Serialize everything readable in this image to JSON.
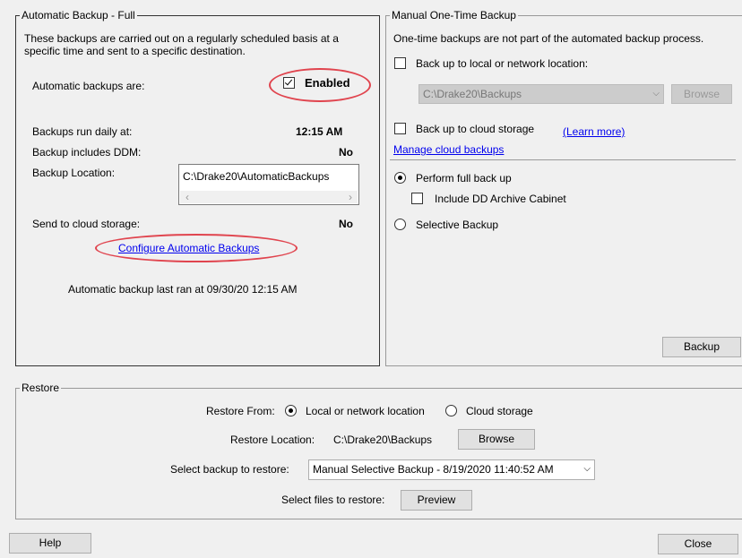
{
  "auto_backup": {
    "title": "Automatic Backup - Full",
    "description_line1": "These backups are carried out on a regularly scheduled basis at a",
    "description_line2": "specific time and sent to a specific destination.",
    "status_label": "Automatic backups are:",
    "enabled_label": "Enabled",
    "enabled_checked": true,
    "run_daily_label": "Backups run daily at:",
    "run_daily_value": "12:15 AM",
    "ddm_label": "Backup includes DDM:",
    "ddm_value": "No",
    "location_label": "Backup Location:",
    "location_value": "C:\\Drake20\\AutomaticBackups",
    "cloud_label": "Send to cloud storage:",
    "cloud_value": "No",
    "configure_link": "Configure Automatic Backups",
    "last_ran": "Automatic backup last ran at 09/30/20 12:15 AM"
  },
  "manual_backup": {
    "title": "Manual One-Time Backup",
    "description": "One-time backups are not part of the automated backup process.",
    "local_label": "Back up to local or network location:",
    "local_checked": false,
    "path_value": "C:\\Drake20\\Backups",
    "browse_label": "Browse",
    "cloud_label": "Back up to cloud storage",
    "cloud_checked": false,
    "learn_more": "(Learn more)",
    "manage_cloud": "Manage cloud backups",
    "full_backup_label": "Perform full back up",
    "archive_label": "Include DD Archive Cabinet",
    "selective_label": "Selective Backup",
    "backup_button": "Backup"
  },
  "restore": {
    "title": "Restore",
    "from_label": "Restore From:",
    "option_local": "Local or network location",
    "option_cloud": "Cloud storage",
    "location_label": "Restore Location:",
    "location_value": "C:\\Drake20\\Backups",
    "browse_label": "Browse",
    "select_label": "Select backup to restore:",
    "select_value": "Manual Selective Backup - 8/19/2020 11:40:52 AM",
    "files_label": "Select files to restore:",
    "preview_label": "Preview"
  },
  "footer": {
    "help_label": "Help",
    "close_label": "Close"
  },
  "colors": {
    "highlight_ellipse": "#e0444e",
    "link": "#0000ee",
    "background": "#f0f0f0"
  },
  "icons": {
    "checkbox": "checkbox-icon",
    "radio": "radio-icon",
    "chevron": "chevron-down-icon",
    "scroll_left": "scroll-left-icon",
    "scroll_right": "scroll-right-icon"
  }
}
